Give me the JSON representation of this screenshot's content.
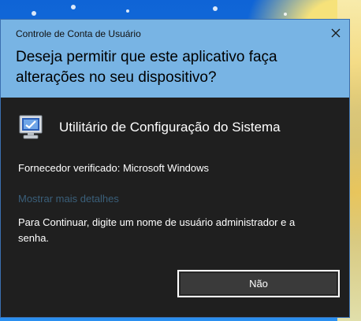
{
  "window": {
    "caption": "Controle de Conta de Usuário",
    "question": "Deseja permitir que este aplicativo faça alterações no seu dispositivo?"
  },
  "app": {
    "name": "Utilitário de Configuração do Sistema",
    "icon": "system-config-monitor-icon"
  },
  "publisher_text": "Fornecedor verificado: Microsoft Windows",
  "more_details_link": "Mostrar mais detalhes",
  "instruction": "Para Continuar, digite um nome de usuário administrador e a senha.",
  "buttons": {
    "no_label": "Não"
  },
  "colors": {
    "header_bg": "#78b4e4",
    "body_bg": "#1f1f1f",
    "link": "#3a5f7a",
    "button_bg": "#3a3a3a"
  }
}
